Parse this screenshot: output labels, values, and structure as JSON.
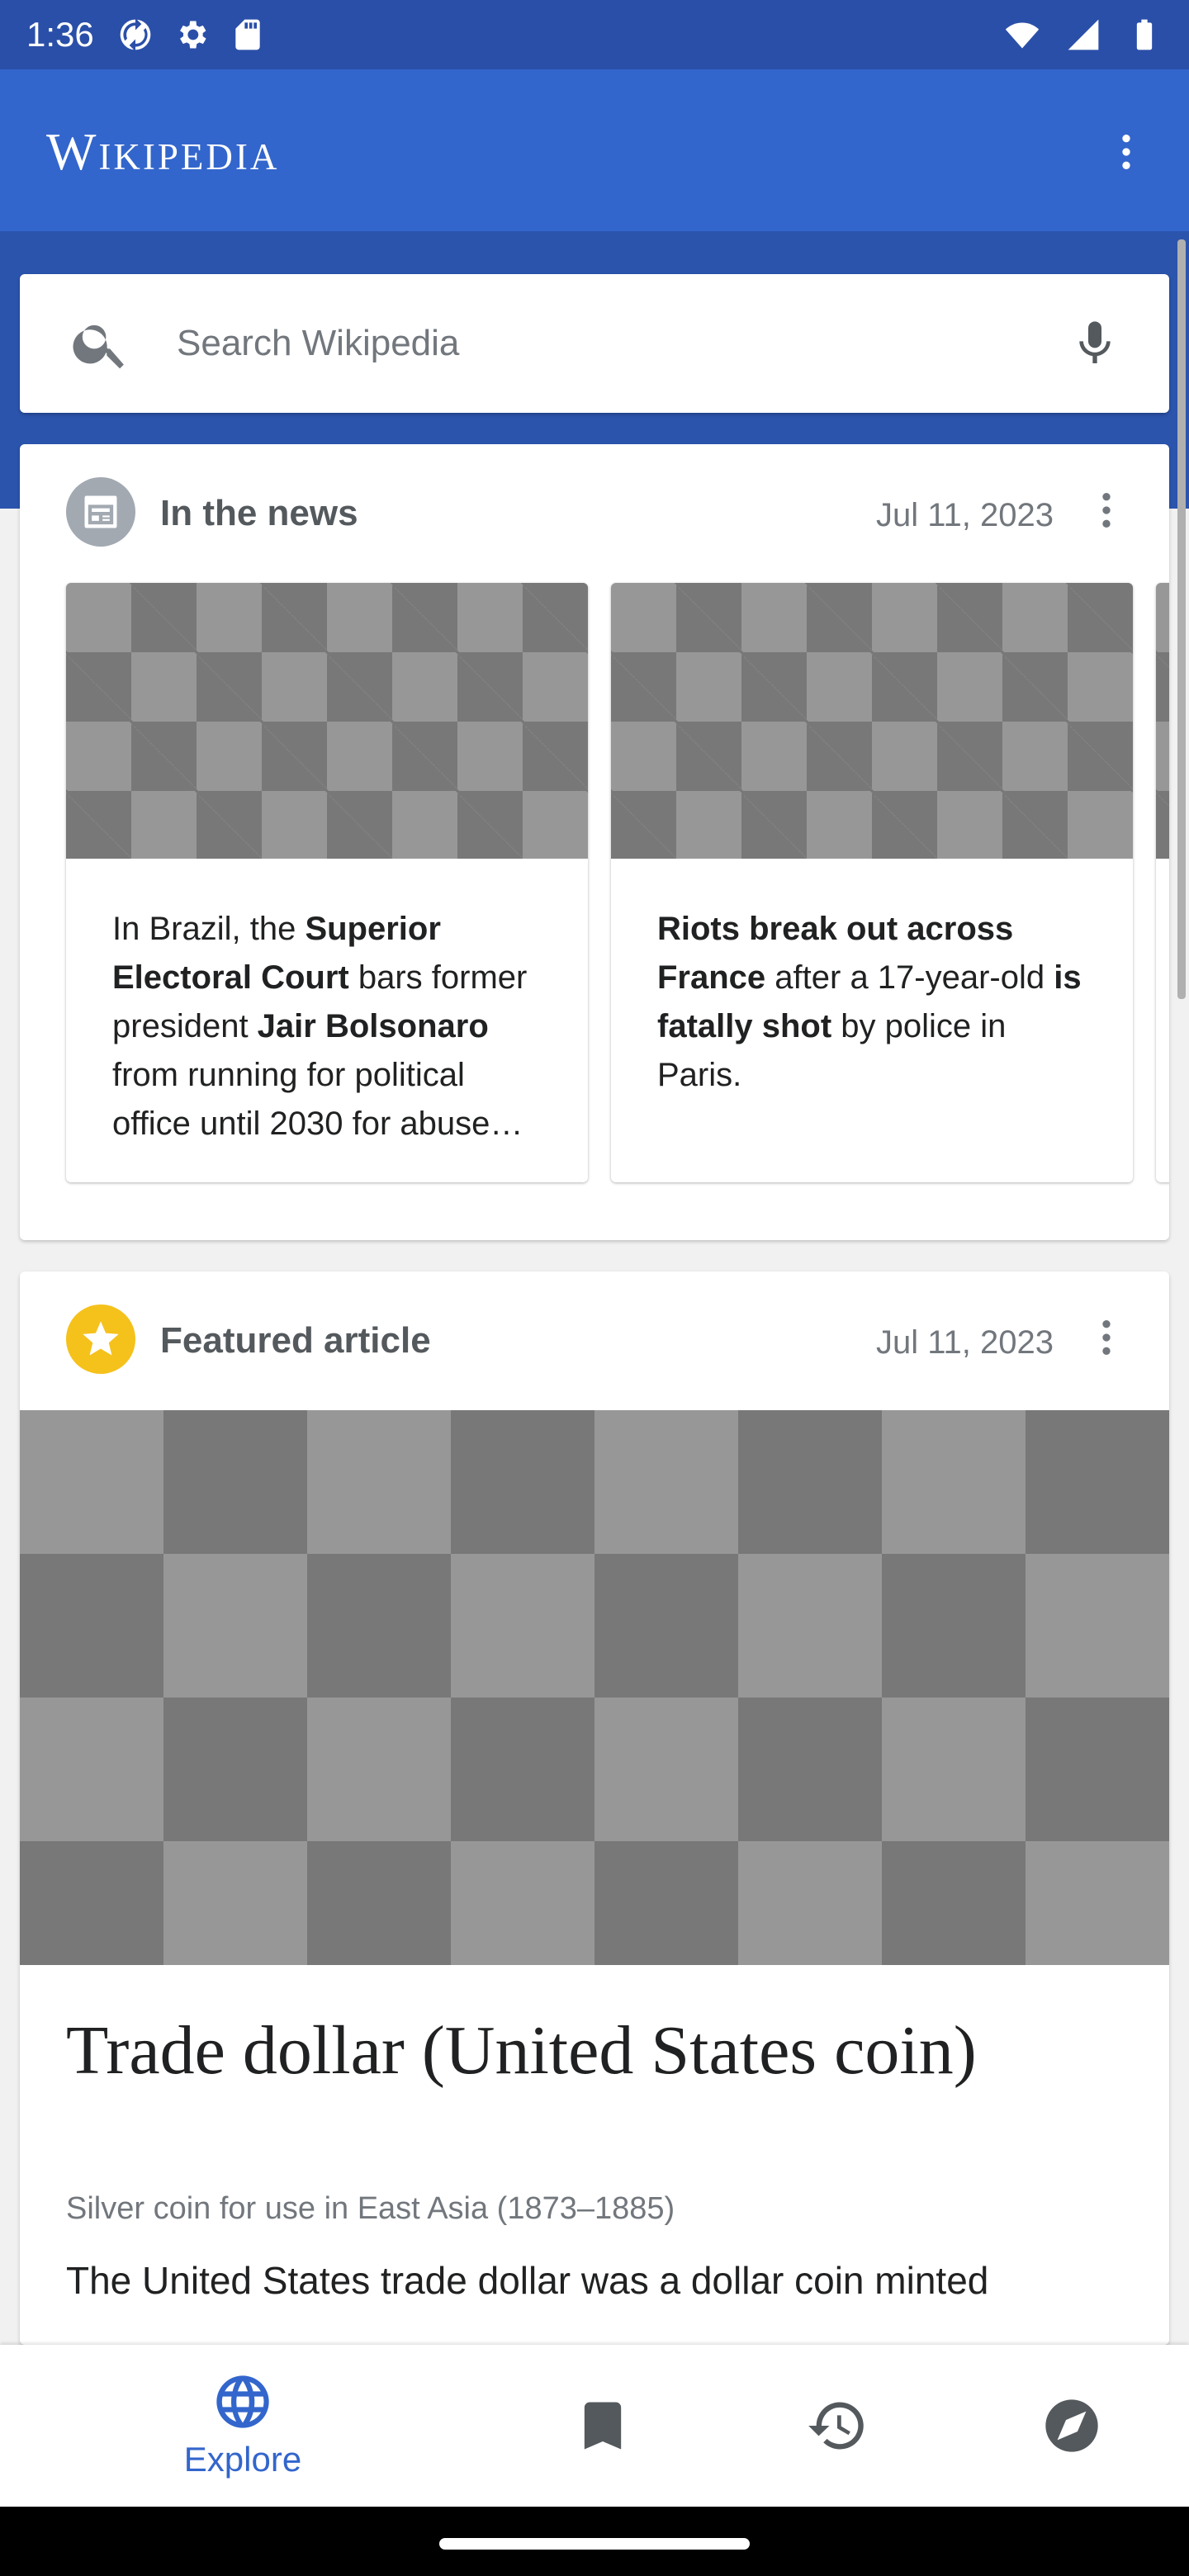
{
  "status_bar": {
    "time": "1:36",
    "left_icons": [
      "sync-icon",
      "settings-icon",
      "sd-card-icon"
    ],
    "right_icons": [
      "wifi-icon",
      "signal-icon",
      "battery-icon"
    ]
  },
  "app_bar": {
    "logo_text": "Wikipedia",
    "menu_icon": "more-vert-icon"
  },
  "search": {
    "placeholder": "Search Wikipedia"
  },
  "news_card": {
    "title": "In the news",
    "date": "Jul 11, 2023",
    "items": [
      {
        "parts": [
          {
            "text": "In Brazil, the ",
            "bold": false
          },
          {
            "text": "Superior Electoral Court",
            "bold": true
          },
          {
            "text": " bars former president ",
            "bold": false
          },
          {
            "text": "Jair Bolsonaro",
            "bold": true
          },
          {
            "text": " from running for political office until 2030 for abuse…",
            "bold": false
          }
        ]
      },
      {
        "parts": [
          {
            "text": "Riots break out across France",
            "bold": true
          },
          {
            "text": " after a 17-year-old ",
            "bold": false
          },
          {
            "text": "is fatally shot",
            "bold": true
          },
          {
            "text": " by police in Paris.",
            "bold": false
          }
        ]
      }
    ]
  },
  "featured_card": {
    "title": "Featured article",
    "date": "Jul 11, 2023",
    "article_title": "Trade dollar (United States coin)",
    "description": "Silver coin for use in East Asia (1873–1885)",
    "extract": "The United States trade dollar was a dollar coin minted"
  },
  "bottom_nav": {
    "items": [
      {
        "label": "Explore",
        "icon": "globe-icon",
        "active": true
      },
      {
        "label": "",
        "icon": "bookmark-icon",
        "active": false
      },
      {
        "label": "",
        "icon": "history-icon",
        "active": false
      },
      {
        "label": "",
        "icon": "compass-icon",
        "active": false
      }
    ]
  },
  "colors": {
    "app_bar": "#3366cc",
    "status_bar": "#2a4fa8",
    "featured_star": "#f5c11b",
    "news_icon": "#a2a9b1"
  }
}
